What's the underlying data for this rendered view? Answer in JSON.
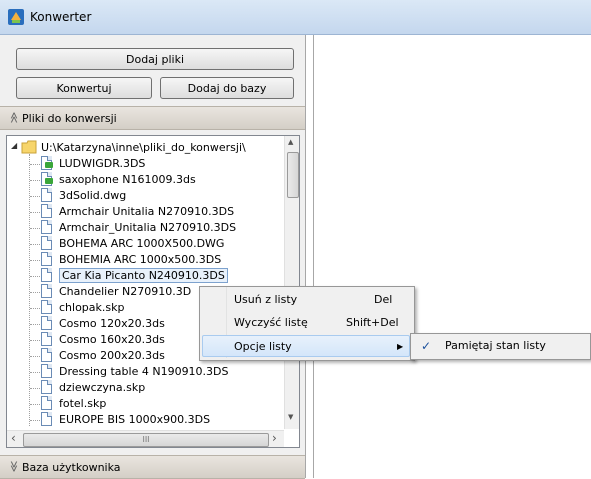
{
  "window": {
    "title": "Konwerter"
  },
  "toolbar": {
    "add_files": "Dodaj pliki",
    "convert": "Konwertuj",
    "add_to_db": "Dodaj do bazy"
  },
  "sections": {
    "files_to_convert": "Pliki do konwersji",
    "user_db": "Baza użytkownika"
  },
  "tree": {
    "root": "U:\\Katarzyna\\inne\\pliki_do_konwersji\\",
    "items": [
      "LUDWIGDR.3DS",
      "saxophone N161009.3ds",
      "3dSolid.dwg",
      "Armchair Unitalia N270910.3DS",
      "Armchair_Unitalia N270910.3DS",
      "BOHEMA ARC 1000X500.DWG",
      "BOHEMIA ARC 1000x500.3DS",
      "Car Kia Picanto N240910.3DS",
      "Chandelier N270910.3D",
      "chlopak.skp",
      "Cosmo 120x20.3ds",
      "Cosmo 160x20.3ds",
      "Cosmo 200x20.3ds",
      "Dressing table 4 N190910.3DS",
      "dziewczyna.skp",
      "fotel.skp",
      "EUROPE BIS 1000x900.3DS"
    ],
    "scroll_left": "‹",
    "scroll_right": "›",
    "scroll_up": "▲",
    "scroll_down": "▼",
    "hscroll_grip": "III"
  },
  "context_menu": {
    "remove": "Usuń z listy",
    "remove_shortcut": "Del",
    "clear": "Wyczyść listę",
    "clear_shortcut": "Shift+Del",
    "options": "Opcje listy",
    "arrow": "▶"
  },
  "submenu": {
    "check": "✓",
    "remember": "Pamiętaj stan listy"
  },
  "icons": {
    "chevron_up": "≫",
    "chevron_down": "≫"
  }
}
